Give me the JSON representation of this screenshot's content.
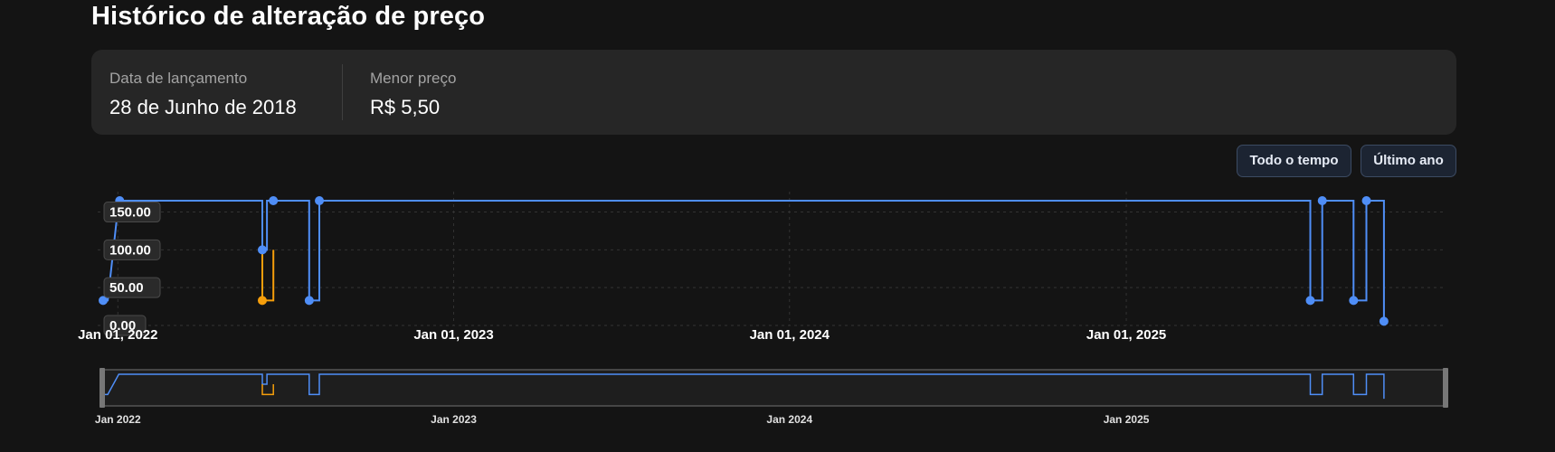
{
  "header": {
    "title": "Histórico de alteração de preço"
  },
  "info": {
    "release_label": "Data de lançamento",
    "release_value": "28 de Junho de 2018",
    "lowest_label": "Menor preço",
    "lowest_value": "R$ 5,50"
  },
  "range_buttons": {
    "all_time": "Todo o tempo",
    "last_year": "Último ano"
  },
  "colors": {
    "primary_series": "#4f8ef7",
    "secondary_series": "#f59e0b",
    "background": "#141414",
    "card": "#262626"
  },
  "chart_data": {
    "type": "line",
    "step": true,
    "title": "",
    "xlabel": "",
    "ylabel": "",
    "xlim": [
      "2021-12-16",
      "2025-12-13"
    ],
    "ylim": [
      0,
      165
    ],
    "y_ticks": [
      "0.00",
      "50.00",
      "100.00",
      "150.00"
    ],
    "x_ticks": [
      "Jan 01, 2022",
      "Jan 01, 2023",
      "Jan 01, 2024",
      "Jan 01, 2025"
    ],
    "grid": true,
    "legend": "none",
    "series": [
      {
        "color": "#4f8ef7",
        "points": [
          {
            "x": "2021-12-16",
            "y": 33
          },
          {
            "x": "2021-12-21",
            "y": 33
          },
          {
            "x": "2022-01-02",
            "y": 165
          },
          {
            "x": "2022-06-07",
            "y": 165
          },
          {
            "x": "2022-06-07",
            "y": 100
          },
          {
            "x": "2022-06-12",
            "y": 100
          },
          {
            "x": "2022-06-12",
            "y": 165
          },
          {
            "x": "2022-07-28",
            "y": 165
          },
          {
            "x": "2022-07-28",
            "y": 33
          },
          {
            "x": "2022-08-08",
            "y": 33
          },
          {
            "x": "2022-08-08",
            "y": 165
          },
          {
            "x": "2025-07-20",
            "y": 165
          },
          {
            "x": "2025-07-20",
            "y": 33
          },
          {
            "x": "2025-08-02",
            "y": 33
          },
          {
            "x": "2025-08-02",
            "y": 165
          },
          {
            "x": "2025-09-05",
            "y": 165
          },
          {
            "x": "2025-09-05",
            "y": 33
          },
          {
            "x": "2025-09-19",
            "y": 33
          },
          {
            "x": "2025-09-19",
            "y": 165
          },
          {
            "x": "2025-10-08",
            "y": 165
          },
          {
            "x": "2025-10-08",
            "y": 5.5
          }
        ]
      },
      {
        "color": "#f59e0b",
        "points": [
          {
            "x": "2022-06-07",
            "y": 100
          },
          {
            "x": "2022-06-07",
            "y": 33
          },
          {
            "x": "2022-06-19",
            "y": 33
          },
          {
            "x": "2022-06-19",
            "y": 100
          }
        ]
      }
    ],
    "markers": [
      {
        "x": "2021-12-16",
        "y": 33,
        "color": "#4f8ef7"
      },
      {
        "x": "2022-01-03",
        "y": 165,
        "color": "#4f8ef7"
      },
      {
        "x": "2022-06-07",
        "y": 100,
        "color": "#4f8ef7"
      },
      {
        "x": "2022-06-07",
        "y": 33,
        "color": "#f59e0b"
      },
      {
        "x": "2022-06-19",
        "y": 165,
        "color": "#4f8ef7"
      },
      {
        "x": "2022-07-28",
        "y": 33,
        "color": "#4f8ef7"
      },
      {
        "x": "2022-08-08",
        "y": 165,
        "color": "#4f8ef7"
      },
      {
        "x": "2025-07-20",
        "y": 33,
        "color": "#4f8ef7"
      },
      {
        "x": "2025-08-02",
        "y": 165,
        "color": "#4f8ef7"
      },
      {
        "x": "2025-09-05",
        "y": 33,
        "color": "#4f8ef7"
      },
      {
        "x": "2025-09-19",
        "y": 165,
        "color": "#4f8ef7"
      },
      {
        "x": "2025-10-08",
        "y": 5.5,
        "color": "#4f8ef7"
      }
    ],
    "navigator": {
      "x_ticks": [
        "Jan 2022",
        "Jan 2023",
        "Jan 2024",
        "Jan 2025"
      ]
    }
  }
}
